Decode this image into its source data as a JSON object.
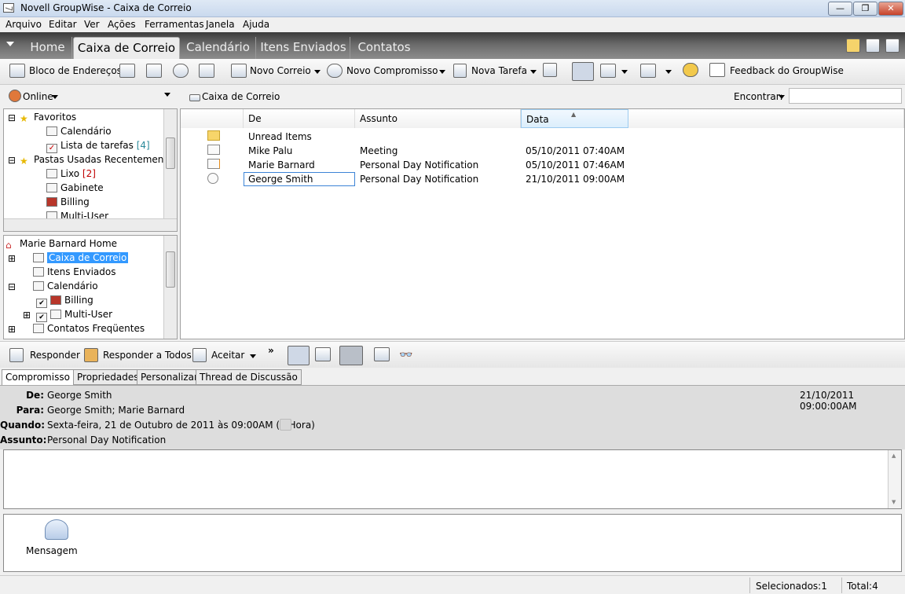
{
  "window": {
    "title": "Novell GroupWise - Caixa de Correio",
    "min": "—",
    "max": "❐",
    "close": "✕"
  },
  "menu": [
    "Arquivo",
    "Editar",
    "Ver",
    "Ações",
    "Ferramentas",
    "Janela",
    "Ajuda"
  ],
  "nav_tabs": [
    "Home",
    "Caixa de Correio",
    "Calendário",
    "Itens Enviados",
    "Contatos"
  ],
  "toolbar": {
    "address_book": "Bloco de Endereços",
    "new_mail": "Novo Correio",
    "new_appointment": "Novo Compromisso",
    "new_task": "Nova Tarefa",
    "feedback": "Feedback do GroupWise"
  },
  "subbar": {
    "online": "Online",
    "location": "Caixa de Correio",
    "find_label": "Encontrar:"
  },
  "favorites": {
    "title": "Favoritos",
    "items": [
      {
        "label": "Calendário"
      },
      {
        "label": "Lista de tarefas",
        "count": "[4]"
      }
    ],
    "recent_title": "Pastas Usadas Recentemente",
    "recent": [
      {
        "label": "Lixo",
        "count": "[2]"
      },
      {
        "label": "Gabinete"
      },
      {
        "label": "Billing"
      },
      {
        "label": "Multi-User"
      }
    ]
  },
  "folders": {
    "home": "Marie Barnard Home",
    "items": [
      "Caixa de Correio",
      "Itens Enviados",
      "Calendário",
      "Billing",
      "Multi-User",
      "Contatos Freqüentes"
    ]
  },
  "list": {
    "headers": {
      "from": "De",
      "subject": "Assunto",
      "date": "Data"
    },
    "rows": [
      {
        "from": "Unread Items",
        "subject": "",
        "date": "",
        "icon": "folder-icon"
      },
      {
        "from": "Mike Palu",
        "subject": "Meeting",
        "date": "05/10/2011 07:40AM",
        "icon": "envelope-open-icon"
      },
      {
        "from": "Marie Barnard",
        "subject": "Personal Day Notification",
        "date": "05/10/2011 07:46AM",
        "icon": "envelope-pin-icon"
      },
      {
        "from": "George Smith",
        "subject": "Personal Day Notification",
        "date": "21/10/2011 09:00AM",
        "icon": "clock-icon"
      }
    ]
  },
  "actions": {
    "reply": "Responder",
    "reply_all": "Responder a Todos",
    "accept": "Aceitar",
    "more": "»"
  },
  "detail_tabs": [
    "Compromisso",
    "Propriedades",
    "Personalizar",
    "Thread de Discussão"
  ],
  "props": {
    "from_label": "De:",
    "from": "George Smith",
    "to_label": "Para:",
    "to": "George Smith; Marie Barnard",
    "when_label": "Quando:",
    "when": "Sexta-feira, 21 de Outubro de 2011 às 09:00AM (1 Hora)",
    "subject_label": "Assunto:",
    "subject": "Personal Day Notification",
    "date": "21/10/2011 09:00:00AM"
  },
  "attachment": {
    "label": "Mensagem"
  },
  "status": {
    "selected": "Selecionados:1",
    "total": "Total:4"
  },
  "colors": {
    "selection": "#3399ff",
    "count": "#2a8a9a",
    "count_red": "#c00000"
  }
}
